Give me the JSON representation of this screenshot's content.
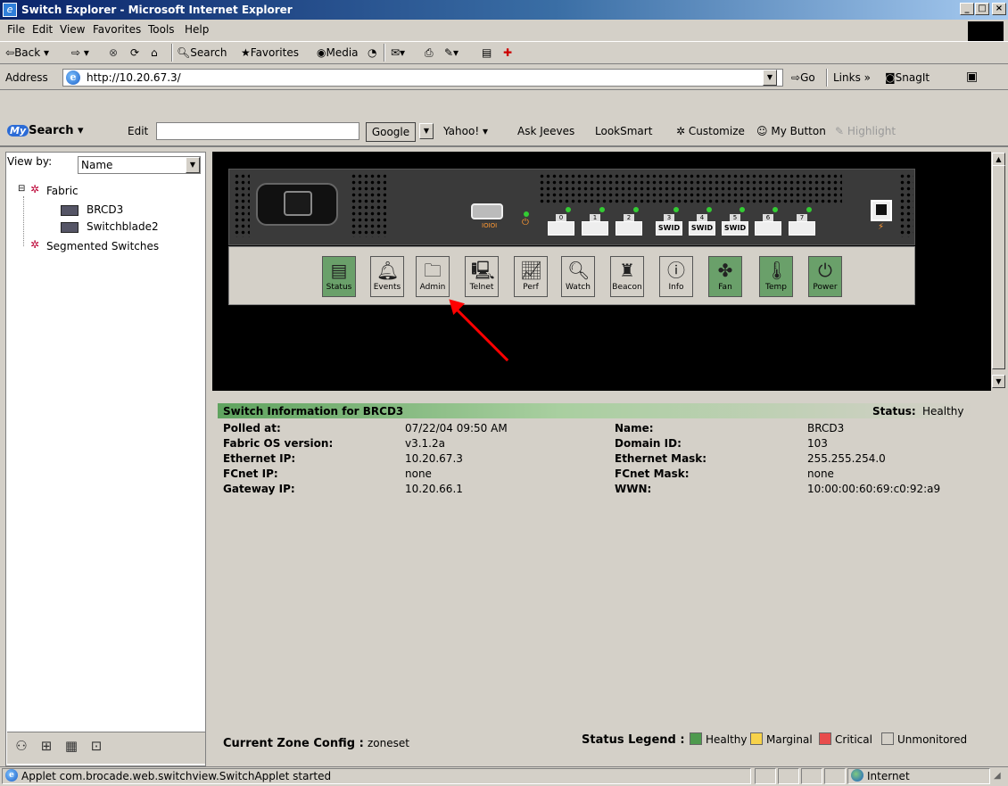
{
  "window": {
    "title": "Switch Explorer - Microsoft Internet Explorer"
  },
  "menu": [
    "File",
    "Edit",
    "View",
    "Favorites",
    "Tools",
    "Help"
  ],
  "toolbar": {
    "back": "Back",
    "search": "Search",
    "favorites": "Favorites",
    "media": "Media"
  },
  "address": {
    "label": "Address",
    "url": "http://10.20.67.3/",
    "go": "Go",
    "links": "Links",
    "snagit": "SnagIt"
  },
  "search_bar": {
    "search_label": "Search",
    "edit": "Edit",
    "google": "Google",
    "items": [
      "Yahoo!",
      "Ask Jeeves",
      "LookSmart",
      "Customize",
      "My Button",
      "Highlight"
    ]
  },
  "left": {
    "view_by_label": "View by:",
    "view_by_value": "Name",
    "tree": [
      "Fabric",
      "BRCD3",
      "Switchblade2",
      "Segmented Switches"
    ]
  },
  "ports": {
    "numbers": [
      "0",
      "1",
      "2",
      "3",
      "4",
      "5",
      "6",
      "7"
    ],
    "labels": [
      "",
      "",
      "",
      "SWID",
      "SWID",
      "SWID",
      "",
      ""
    ]
  },
  "applet_buttons": [
    "Status",
    "Events",
    "Admin",
    "Telnet",
    "Perf",
    "Watch",
    "Beacon",
    "Info",
    "Fan",
    "Temp",
    "Power"
  ],
  "info": {
    "header": "Switch Information for BRCD3",
    "status_label": "Status:",
    "status_value": "Healthy",
    "fields_left": [
      {
        "label": "Polled at:",
        "value": "07/22/04 09:50 AM"
      },
      {
        "label": "Fabric OS version:",
        "value": "v3.1.2a"
      },
      {
        "label": "Ethernet IP:",
        "value": "10.20.67.3"
      },
      {
        "label": "FCnet IP:",
        "value": "none"
      },
      {
        "label": "Gateway IP:",
        "value": "10.20.66.1"
      }
    ],
    "fields_right": [
      {
        "label": "Name:",
        "value": "BRCD3"
      },
      {
        "label": "Domain ID:",
        "value": "103"
      },
      {
        "label": "Ethernet Mask:",
        "value": "255.255.254.0"
      },
      {
        "label": "FCnet Mask:",
        "value": "none"
      },
      {
        "label": "WWN:",
        "value": "10:00:00:60:69:c0:92:a9"
      }
    ],
    "zone_label": "Current Zone Config :",
    "zone_value": "zoneset",
    "legend_label": "Status Legend :",
    "legend": [
      {
        "label": "Healthy",
        "color": "#4e9a4e"
      },
      {
        "label": "Marginal",
        "color": "#f7d24a"
      },
      {
        "label": "Critical",
        "color": "#e84c4c"
      },
      {
        "label": "Unmonitored",
        "color": "#d4d0c8"
      }
    ]
  },
  "statusbar": {
    "text": "Applet com.brocade.web.switchview.SwitchApplet started",
    "zone": "Internet"
  }
}
